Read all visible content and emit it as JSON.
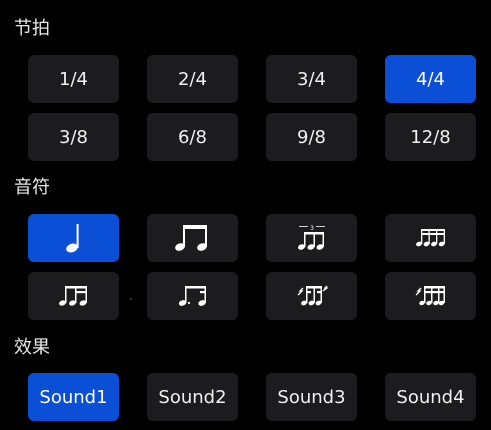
{
  "sections": {
    "meter": {
      "title": "节拍",
      "items": [
        "1/4",
        "2/4",
        "3/4",
        "4/4",
        "3/8",
        "6/8",
        "9/8",
        "12/8"
      ],
      "selected": "4/4"
    },
    "note": {
      "title": "音符",
      "items": [
        {
          "icon": "quarter-note-icon"
        },
        {
          "icon": "eighth-notes-icon"
        },
        {
          "icon": "triplet-notes-icon"
        },
        {
          "icon": "sixteenth-notes-icon"
        },
        {
          "icon": "eighth-two-sixteenths-icon"
        },
        {
          "icon": "dotted-eighth-sixteenth-icon"
        },
        {
          "icon": "sixteenth-eighth-sixteenth-icon"
        },
        {
          "icon": "two-sixteenths-eighth-icon"
        }
      ],
      "selected_index": 0
    },
    "effect": {
      "title": "效果",
      "items": [
        "Sound1",
        "Sound2",
        "Sound3",
        "Sound4"
      ],
      "selected": "Sound1"
    }
  },
  "colors": {
    "background": "#000000",
    "button": "#1c1c1e",
    "accent": "#0a4fd6",
    "text": "#f0f0f0"
  }
}
